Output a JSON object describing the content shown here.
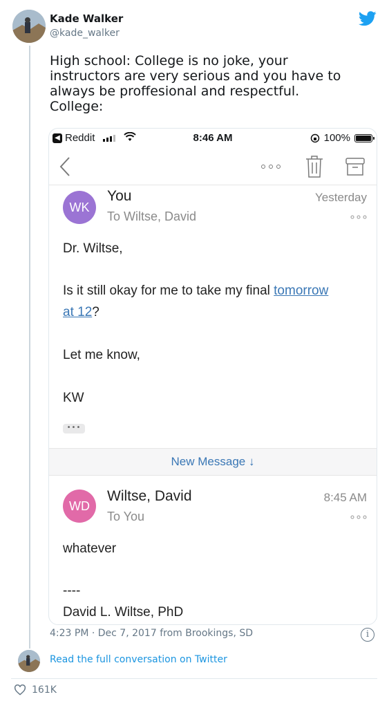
{
  "tweet": {
    "author_name": "Kade Walker",
    "author_handle": "@kade_walker",
    "text_lines": [
      "High school: College is no joke, your",
      "instructors are very serious and you have to",
      "always be proffesional and respectful.",
      "College:"
    ],
    "meta": "4:23 PM · Dec 7, 2017 from Brookings, SD",
    "read_full": "Read the full conversation on Twitter",
    "likes": "161K"
  },
  "phone": {
    "status": {
      "back_app": "Reddit",
      "time": "8:46 AM",
      "battery": "100%"
    },
    "messages": [
      {
        "initials": "WK",
        "avatar_color": "#9b74d4",
        "sender": "You",
        "recipient": "To Wiltse, David",
        "time": "Yesterday",
        "greeting": "Dr. Wiltse,",
        "line1_pre": "Is it still okay for me to take my final ",
        "line1_link": "tomorrow",
        "line2_link": "at 12",
        "line2_post": "?",
        "line3": "Let me know,",
        "sign": "KW"
      },
      {
        "initials": "WD",
        "avatar_color": "#e16aa8",
        "sender": "Wiltse, David",
        "recipient": "To You",
        "time": "8:45 AM",
        "body": "whatever",
        "separator": "----",
        "signature": "David L. Wiltse, PhD"
      }
    ],
    "new_message": "New Message ↓"
  },
  "colors": {
    "twitter_blue": "#1da1f2",
    "link_blue": "#3a77b5"
  }
}
